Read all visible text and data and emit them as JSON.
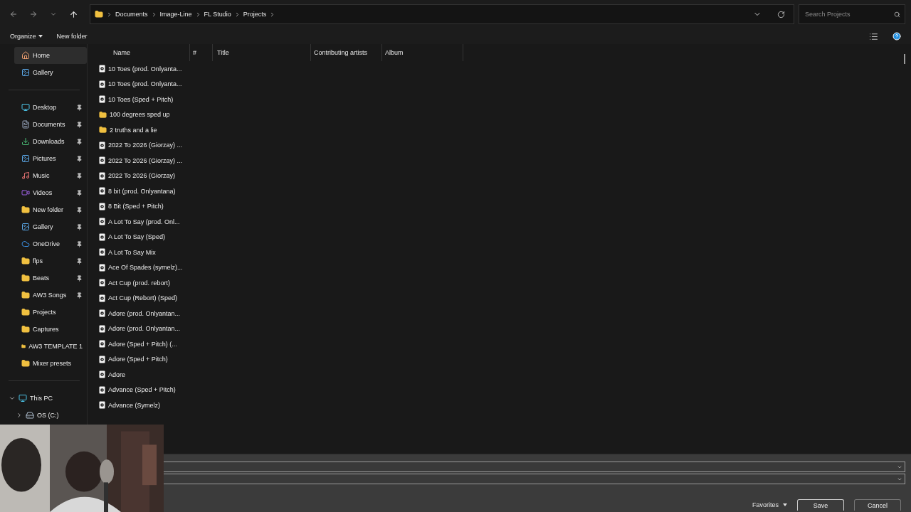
{
  "nav": {
    "path": [
      "Documents",
      "Image-Line",
      "FL Studio",
      "Projects"
    ],
    "search": {
      "placeholder": "Search Projects"
    }
  },
  "toolbar": {
    "buttons": [
      "Organize",
      "New folder"
    ]
  },
  "sidebar": {
    "groups": [
      {
        "items": [
          {
            "label": "Home",
            "kind": "home",
            "selected": true,
            "pinned": false
          },
          {
            "label": "Gallery",
            "kind": "gallery",
            "selected": false,
            "pinned": false
          }
        ]
      },
      {
        "items": [
          {
            "label": "Desktop",
            "kind": "desktop",
            "selected": false,
            "pinned": true
          },
          {
            "label": "Documents",
            "kind": "documents",
            "selected": false,
            "pinned": true
          },
          {
            "label": "Downloads",
            "kind": "downloads",
            "selected": false,
            "pinned": true
          },
          {
            "label": "Pictures",
            "kind": "gallery",
            "selected": false,
            "pinned": true
          },
          {
            "label": "Music",
            "kind": "music",
            "selected": false,
            "pinned": true
          },
          {
            "label": "Videos",
            "kind": "videos",
            "selected": false,
            "pinned": true
          },
          {
            "label": "New folder",
            "kind": "folder",
            "selected": false,
            "pinned": true
          },
          {
            "label": "Gallery",
            "kind": "gallery",
            "selected": false,
            "pinned": true
          },
          {
            "label": "OneDrive",
            "kind": "cloud",
            "selected": false,
            "pinned": true
          },
          {
            "label": "flps",
            "kind": "folder",
            "selected": false,
            "pinned": true
          },
          {
            "label": "Beats",
            "kind": "folder",
            "selected": false,
            "pinned": true
          },
          {
            "label": "AW3 Songs",
            "kind": "folder",
            "selected": false,
            "pinned": true
          },
          {
            "label": "Projects",
            "kind": "folder",
            "selected": false,
            "pinned": false
          },
          {
            "label": "Captures",
            "kind": "folder",
            "selected": false,
            "pinned": false
          },
          {
            "label": "AW3 TEMPLATE 1",
            "kind": "folder",
            "selected": false,
            "pinned": false
          },
          {
            "label": "Mixer presets",
            "kind": "folder",
            "selected": false,
            "pinned": false
          }
        ]
      },
      {
        "items": [
          {
            "label": "This PC",
            "kind": "pc",
            "selected": false,
            "expanded": true,
            "children": [
              {
                "label": "OS (C:)",
                "kind": "drive",
                "selected": false,
                "expanded": false
              }
            ]
          }
        ]
      }
    ]
  },
  "table": {
    "columns": [
      "Name",
      "#",
      "Title",
      "Contributing artists",
      "Album"
    ],
    "rows": [
      {
        "name": "10 Toes (prod. Onlyanta...",
        "kind": "file"
      },
      {
        "name": "10 Toes (prod. Onlyanta...",
        "kind": "file"
      },
      {
        "name": "10 Toes (Sped + Pitch)",
        "kind": "file"
      },
      {
        "name": "100 degrees sped up",
        "kind": "folder"
      },
      {
        "name": "2 truths and a lie",
        "kind": "folder"
      },
      {
        "name": "2022 To 2026 (Giorzay) ...",
        "kind": "file"
      },
      {
        "name": "2022 To 2026 (Giorzay) ...",
        "kind": "file"
      },
      {
        "name": "2022 To 2026 (Giorzay)",
        "kind": "file"
      },
      {
        "name": "8 bit (prod. Onlyantana)",
        "kind": "file"
      },
      {
        "name": "8 Bit (Sped + Pitch)",
        "kind": "file"
      },
      {
        "name": "A Lot To Say (prod. Onl...",
        "kind": "file"
      },
      {
        "name": "A Lot To Say (Sped)",
        "kind": "file"
      },
      {
        "name": "A Lot To Say Mix",
        "kind": "file"
      },
      {
        "name": "Ace Of Spades (symelz)...",
        "kind": "file"
      },
      {
        "name": "Act Cup (prod. rebort)",
        "kind": "file"
      },
      {
        "name": "Act Cup (Rebort) (Sped)",
        "kind": "file"
      },
      {
        "name": "Adore (prod. Onlyantan...",
        "kind": "file"
      },
      {
        "name": "Adore (prod. Onlyantan...",
        "kind": "file"
      },
      {
        "name": "Adore (Sped + Pitch) (...",
        "kind": "file"
      },
      {
        "name": "Adore (Sped + Pitch)",
        "kind": "file"
      },
      {
        "name": "Adore",
        "kind": "file"
      },
      {
        "name": "Advance (Sped + Pitch)",
        "kind": "file"
      },
      {
        "name": "Advance (Symelz)",
        "kind": "file"
      }
    ]
  },
  "footer": {
    "fields": [
      {
        "kind": "dropdown"
      },
      {
        "kind": "dropdown"
      }
    ],
    "favorites": "Favorites",
    "buttons": [
      "Save",
      "Cancel"
    ]
  }
}
